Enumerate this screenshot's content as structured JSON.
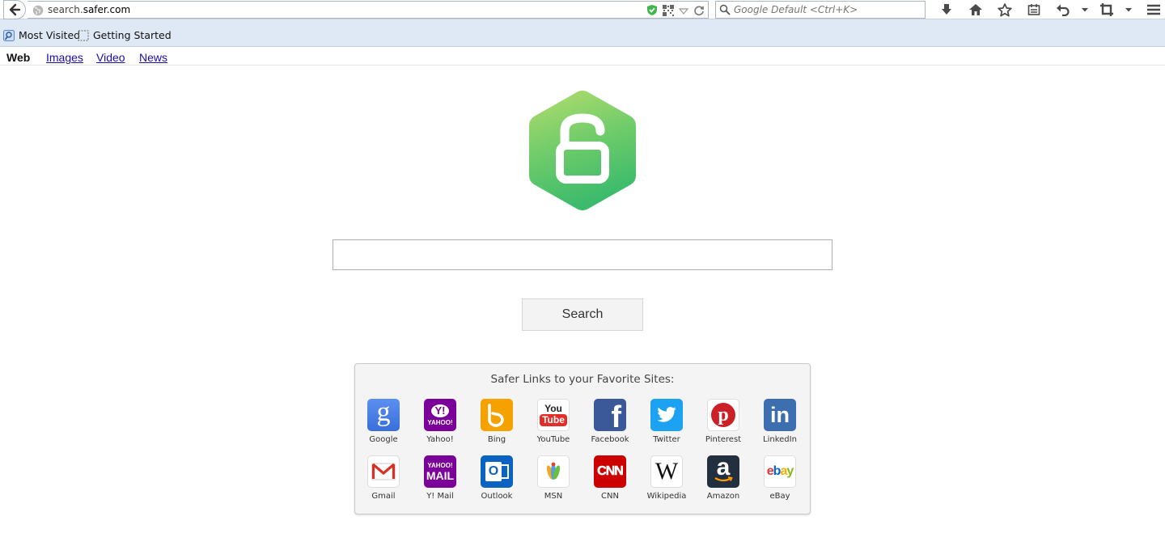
{
  "browser": {
    "url_host_prefix": "search.",
    "url_host_domain": "safer.com",
    "search_placeholder": "Google Default <Ctrl+K>"
  },
  "bookmarks": {
    "most_visited": "Most Visited",
    "getting_started": "Getting Started"
  },
  "page_nav": {
    "web": "Web",
    "images": "Images",
    "video": "Video",
    "news": "News"
  },
  "search": {
    "query": "",
    "button_label": "Search"
  },
  "favorites": {
    "title": "Safer Links to your Favorite Sites:",
    "sites": [
      {
        "label": "Google",
        "icon": "google-icon",
        "color": "#4a7ee8"
      },
      {
        "label": "Yahoo!",
        "icon": "yahoo-icon",
        "color": "#7b0099"
      },
      {
        "label": "Bing",
        "icon": "bing-icon",
        "color": "#f5a100"
      },
      {
        "label": "YouTube",
        "icon": "youtube-icon",
        "color": "#e52d27"
      },
      {
        "label": "Facebook",
        "icon": "facebook-icon",
        "color": "#3b5998"
      },
      {
        "label": "Twitter",
        "icon": "twitter-icon",
        "color": "#1da1f2"
      },
      {
        "label": "Pinterest",
        "icon": "pinterest-icon",
        "color": "#cb2027"
      },
      {
        "label": "LinkedIn",
        "icon": "linkedin-icon",
        "color": "#3d6fb0"
      },
      {
        "label": "Gmail",
        "icon": "gmail-icon",
        "color": "#d93025"
      },
      {
        "label": "Y! Mail",
        "icon": "yahoo-mail-icon",
        "color": "#7b0099"
      },
      {
        "label": "Outlook",
        "icon": "outlook-icon",
        "color": "#0a63c0"
      },
      {
        "label": "MSN",
        "icon": "msn-icon",
        "color": "#f4f4f4"
      },
      {
        "label": "CNN",
        "icon": "cnn-icon",
        "color": "#cc0000"
      },
      {
        "label": "Wikipedia",
        "icon": "wikipedia-icon",
        "color": "#ffffff"
      },
      {
        "label": "Amazon",
        "icon": "amazon-icon",
        "color": "#232f3e"
      },
      {
        "label": "eBay",
        "icon": "ebay-icon",
        "color": "#ffffff"
      }
    ],
    "icon_text": {
      "google": "g",
      "yahoo_mark": "Y!",
      "yahoo_word": "YAHOO!",
      "youtube_you": "You",
      "youtube_tube": "Tube",
      "facebook": "f",
      "pinterest": "p",
      "linkedin": "in",
      "gmail": "M",
      "ymail_top": "YAHOO!",
      "ymail_bottom": "MAIL",
      "outlook": "O",
      "cnn": "CNN",
      "wikipedia": "W",
      "amazon": "a",
      "ebay_e": "e",
      "ebay_b": "b",
      "ebay_a": "a",
      "ebay_y": "y"
    }
  }
}
